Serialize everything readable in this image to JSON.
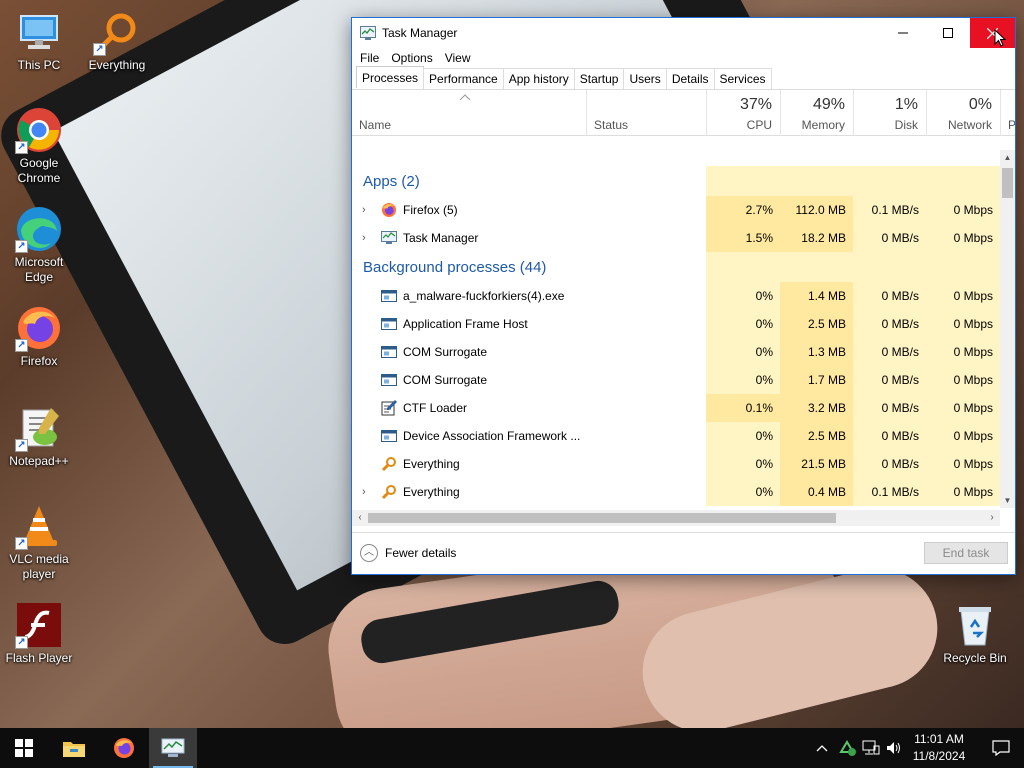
{
  "desktop": {
    "icons": [
      {
        "name": "This PC"
      },
      {
        "name": "Everything"
      },
      {
        "name": "Google Chrome"
      },
      {
        "name": "Microsoft Edge"
      },
      {
        "name": "Firefox"
      },
      {
        "name": "Notepad++"
      },
      {
        "name": "VLC media player"
      },
      {
        "name": "Flash Player"
      },
      {
        "name": "Recycle Bin"
      }
    ]
  },
  "window": {
    "title": "Task Manager",
    "menu": [
      "File",
      "Options",
      "View"
    ],
    "tabs": [
      "Processes",
      "Performance",
      "App history",
      "Startup",
      "Users",
      "Details",
      "Services"
    ],
    "active_tab": "Processes",
    "columns": {
      "name": "Name",
      "status": "Status",
      "cpu": {
        "pct": "37%",
        "label": "CPU"
      },
      "memory": {
        "pct": "49%",
        "label": "Memory"
      },
      "disk": {
        "pct": "1%",
        "label": "Disk"
      },
      "network": {
        "pct": "0%",
        "label": "Network"
      },
      "power_cut": "P"
    },
    "groups": {
      "apps": "Apps (2)",
      "background": "Background processes (44)"
    },
    "apps": [
      {
        "name": "Firefox (5)",
        "cpu": "2.7%",
        "memory": "112.0 MB",
        "disk": "0.1 MB/s",
        "network": "0 Mbps",
        "icon": "firefox-icon"
      },
      {
        "name": "Task Manager",
        "cpu": "1.5%",
        "memory": "18.2 MB",
        "disk": "0 MB/s",
        "network": "0 Mbps",
        "icon": "task-manager-icon"
      }
    ],
    "background": [
      {
        "name": "a_malware-fuckforkiers(4).exe",
        "cpu": "0%",
        "memory": "1.4 MB",
        "disk": "0 MB/s",
        "network": "0 Mbps",
        "icon": "window-app-icon"
      },
      {
        "name": "Application Frame Host",
        "cpu": "0%",
        "memory": "2.5 MB",
        "disk": "0 MB/s",
        "network": "0 Mbps",
        "icon": "window-app-icon"
      },
      {
        "name": "COM Surrogate",
        "cpu": "0%",
        "memory": "1.3 MB",
        "disk": "0 MB/s",
        "network": "0 Mbps",
        "icon": "window-app-icon"
      },
      {
        "name": "COM Surrogate",
        "cpu": "0%",
        "memory": "1.7 MB",
        "disk": "0 MB/s",
        "network": "0 Mbps",
        "icon": "window-app-icon"
      },
      {
        "name": "CTF Loader",
        "cpu": "0.1%",
        "memory": "3.2 MB",
        "disk": "0 MB/s",
        "network": "0 Mbps",
        "icon": "ctf-loader-icon"
      },
      {
        "name": "Device Association Framework ...",
        "cpu": "0%",
        "memory": "2.5 MB",
        "disk": "0 MB/s",
        "network": "0 Mbps",
        "icon": "window-app-icon"
      },
      {
        "name": "Everything",
        "cpu": "0%",
        "memory": "21.5 MB",
        "disk": "0 MB/s",
        "network": "0 Mbps",
        "icon": "everything-icon"
      },
      {
        "name": "Everything",
        "cpu": "0%",
        "memory": "0.4 MB",
        "disk": "0.1 MB/s",
        "network": "0 Mbps",
        "icon": "everything-icon"
      }
    ],
    "footer": {
      "fewer_details": "Fewer details",
      "end_task": "End task"
    }
  },
  "taskbar": {
    "time": "11:01 AM",
    "date": "11/8/2024"
  },
  "colors": {
    "close_red": "#e81123",
    "cpu_heat_light": "#fff4c4",
    "cpu_heat_mid": "#ffe9a1",
    "group_blue": "#1e5aa8",
    "taskbar": "#0d0d0d"
  }
}
